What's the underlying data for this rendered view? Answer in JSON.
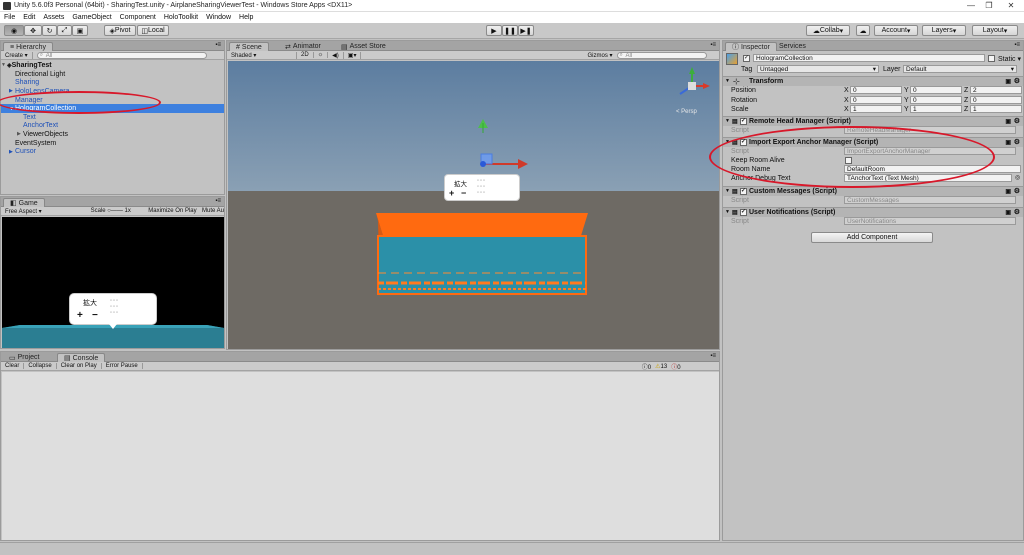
{
  "window": {
    "title": "Unity 5.6.0f3 Personal (64bit) - SharingTest.unity - AirplaneSharingViewerTest - Windows Store Apps <DX11>"
  },
  "menu": [
    "File",
    "Edit",
    "Assets",
    "GameObject",
    "Component",
    "HoloToolkit",
    "Window",
    "Help"
  ],
  "toolbar": {
    "pivot": "Pivot",
    "local": "Local",
    "collab": "Collab",
    "account": "Account",
    "layers": "Layers",
    "layout": "Layout"
  },
  "hierarchy": {
    "tab": "Hierarchy",
    "create": "Create",
    "search_placeholder": "All",
    "scene": "SharingTest",
    "items": [
      {
        "label": "Directional Light",
        "indent": 1,
        "expand": "",
        "blue": false,
        "selected": false
      },
      {
        "label": "Sharing",
        "indent": 1,
        "expand": "",
        "blue": true,
        "selected": false
      },
      {
        "label": "HoloLensCamera",
        "indent": 1,
        "expand": "right",
        "blue": true,
        "selected": false
      },
      {
        "label": "Manager",
        "indent": 1,
        "expand": "",
        "blue": true,
        "selected": false
      },
      {
        "label": "HologramCollection",
        "indent": 1,
        "expand": "down",
        "blue": false,
        "selected": true
      },
      {
        "label": "Text",
        "indent": 2,
        "expand": "",
        "blue": true,
        "selected": false
      },
      {
        "label": "AnchorText",
        "indent": 2,
        "expand": "",
        "blue": true,
        "selected": false
      },
      {
        "label": "ViewerObjects",
        "indent": 2,
        "expand": "right",
        "blue": false,
        "selected": false
      },
      {
        "label": "EventSystem",
        "indent": 1,
        "expand": "",
        "blue": false,
        "selected": false
      },
      {
        "label": "Cursor",
        "indent": 1,
        "expand": "right",
        "blue": true,
        "selected": false
      }
    ]
  },
  "scene": {
    "tabs": [
      "Scene",
      "Animator",
      "Asset Store"
    ],
    "shaded": "Shaded",
    "mode2d": "2D",
    "gizmos": "Gizmos",
    "search_placeholder": "All",
    "persp": "< Persp",
    "menu_title": "拡大",
    "menu_plus": "+",
    "menu_minus": "−"
  },
  "game": {
    "tab": "Game",
    "aspect": "Free Aspect",
    "scale_label": "Scale",
    "scale_value": "1x",
    "maximize": "Maximize On Play",
    "mute": "Mute Au",
    "menu_title": "拡大",
    "menu_plus": "+",
    "menu_minus": "−"
  },
  "console": {
    "tabs": [
      "Project",
      "Console"
    ],
    "buttons": [
      "Clear",
      "Collapse",
      "Clear on Play",
      "Error Pause"
    ],
    "counts": {
      "log": "0",
      "warn": "13",
      "error": "0"
    }
  },
  "inspector": {
    "tabs": [
      "Inspector",
      "Services"
    ],
    "object_name": "HologramCollection",
    "static_label": "Static",
    "tag_label": "Tag",
    "tag_value": "Untagged",
    "layer_label": "Layer",
    "layer_value": "Default",
    "transform": {
      "title": "Transform",
      "rows": [
        {
          "label": "Position",
          "x": "0",
          "y": "0",
          "z": "2"
        },
        {
          "label": "Rotation",
          "x": "0",
          "y": "0",
          "z": "0"
        },
        {
          "label": "Scale",
          "x": "1",
          "y": "1",
          "z": "1"
        }
      ]
    },
    "components": {
      "remote_title": "Remote Head Manager (Script)",
      "remote_script": "RemoteHeadManager",
      "import_title": "Import Export Anchor Manager (Script)",
      "import_script": "ImportExportAnchorManager",
      "keep_room_alive": "Keep Room Alive",
      "room_name_label": "Room Name",
      "room_name_value": "DefaultRoom",
      "anchor_debug_label": "Anchor Debug Text",
      "anchor_debug_value": "AnchorText (Text Mesh)",
      "custom_title": "Custom Messages (Script)",
      "custom_script": "CustomMessages",
      "user_title": "User Notifications (Script)",
      "user_script": "UserNotifications",
      "script_label": "Script"
    },
    "add_component": "Add Component"
  },
  "colors": {
    "selection": "#3d80df",
    "annotation_red": "#d8182a",
    "scene_sky": "#5a7896",
    "scene_ground": "#6e6a64",
    "cube_orange": "#ff6a10",
    "cube_teal": "#2b90a8"
  }
}
